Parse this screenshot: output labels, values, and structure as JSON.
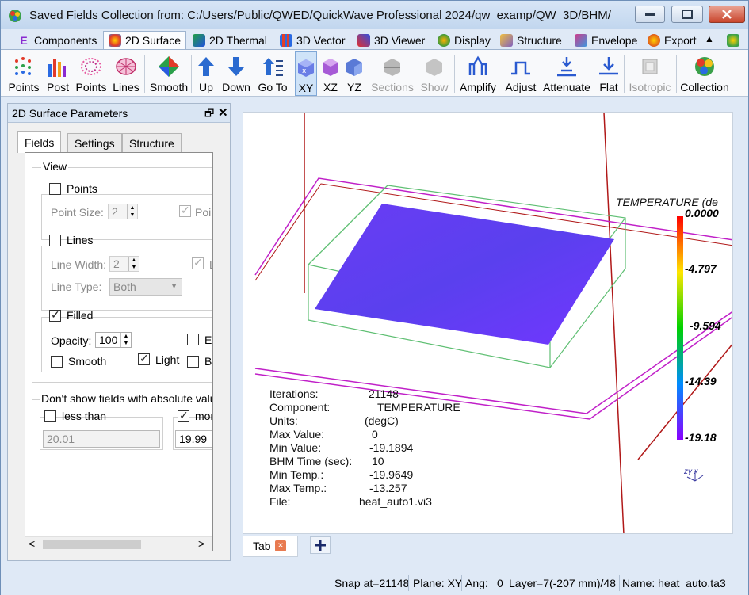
{
  "window": {
    "title": "Saved Fields Collection from: C:/Users/Public/QWED/QuickWave Professional 2024/qw_examp/QW_3D/BHM/"
  },
  "ribbon_tabs": [
    {
      "label": "Components",
      "icon": "e-component-icon"
    },
    {
      "label": "2D Surface",
      "icon": "surface-icon"
    },
    {
      "label": "2D Thermal",
      "icon": "thermal-icon"
    },
    {
      "label": "3D Vector",
      "icon": "vector-icon"
    },
    {
      "label": "3D Viewer",
      "icon": "viewer-icon"
    },
    {
      "label": "Display",
      "icon": "display-icon"
    },
    {
      "label": "Structure",
      "icon": "structure-icon"
    },
    {
      "label": "Envelope",
      "icon": "envelope-icon"
    },
    {
      "label": "Export",
      "icon": "export-icon"
    }
  ],
  "toolbar": {
    "points1": "Points",
    "post": "Post",
    "points2": "Points",
    "lines": "Lines",
    "smooth": "Smooth",
    "up": "Up",
    "down": "Down",
    "goto": "Go To",
    "xy": "XY",
    "xz": "XZ",
    "yz": "YZ",
    "sections": "Sections",
    "show": "Show",
    "amplify": "Amplify",
    "adjust": "Adjust",
    "attenuate": "Attenuate",
    "flat": "Flat",
    "isotropic": "Isotropic",
    "collection": "Collection"
  },
  "panel": {
    "title": "2D Surface Parameters",
    "pin": "🗗",
    "close": "✕",
    "tabs": [
      "Fields",
      "Settings",
      "Structure"
    ],
    "view_group": "View",
    "points_label": "Points",
    "point_size_label": "Point Size:",
    "point_size_value": "2",
    "poin_cut": "Poin",
    "lines_label": "Lines",
    "line_width_label": "Line Width:",
    "line_width_value": "2",
    "l_cut": "L",
    "line_type_label": "Line Type:",
    "line_type_value": "Both",
    "filled_label": "Filled",
    "opacity_label": "Opacity:",
    "opacity_value": "100",
    "ed_cut": "Ed",
    "smooth_label": "Smooth",
    "light_label": "Light",
    "ba_cut": "Ba",
    "abs_group": "Don't show fields with absolute valu",
    "less_than_label": "less than",
    "less_than_value": "20.01",
    "more_label": "mor",
    "more_value": "19.99",
    "scroll_left": "<",
    "scroll_right": ">"
  },
  "viewport": {
    "legend_title": "TEMPERATURE (de",
    "legend_ticks": [
      "0.0000",
      "-4.797",
      "-9.594",
      "-14.39",
      "-19.18"
    ],
    "legend_colors": [
      "#ff0000",
      "#ffe600",
      "#00d200",
      "#008cff",
      "#8a00ff"
    ],
    "info": [
      {
        "key": "Iterations:",
        "value": "21148"
      },
      {
        "key": "Component:",
        "value": "TEMPERATURE"
      },
      {
        "key": "Units:",
        "value": "(degC)"
      },
      {
        "key": "Max Value:",
        "value": "0"
      },
      {
        "key": "Min Value:",
        "value": "-19.1894"
      },
      {
        "key": "BHM Time (sec):",
        "value": "10"
      },
      {
        "key": "Min Temp.:",
        "value": "-19.9649"
      },
      {
        "key": "Max Temp.:",
        "value": "-13.257"
      },
      {
        "key": "File:",
        "value": "heat_auto1.vi3"
      }
    ],
    "axes_label": "zy x"
  },
  "bottom_tabs": {
    "tab_label": "Tab",
    "tab_close": "×",
    "add": "+"
  },
  "status": {
    "snap": "Snap at=21148",
    "plane": "Plane: XY",
    "ang": "Ang:",
    "ang_value": "0",
    "layer": "Layer=7(-207 mm)/48",
    "name": "Name: heat_auto.ta3"
  },
  "colors": {
    "surface_start": "#5a2bf0",
    "surface_end": "#6a3cff",
    "box_outline": "#5fbf73",
    "red_line": "#b01818",
    "magenta_line": "#c020c8"
  }
}
